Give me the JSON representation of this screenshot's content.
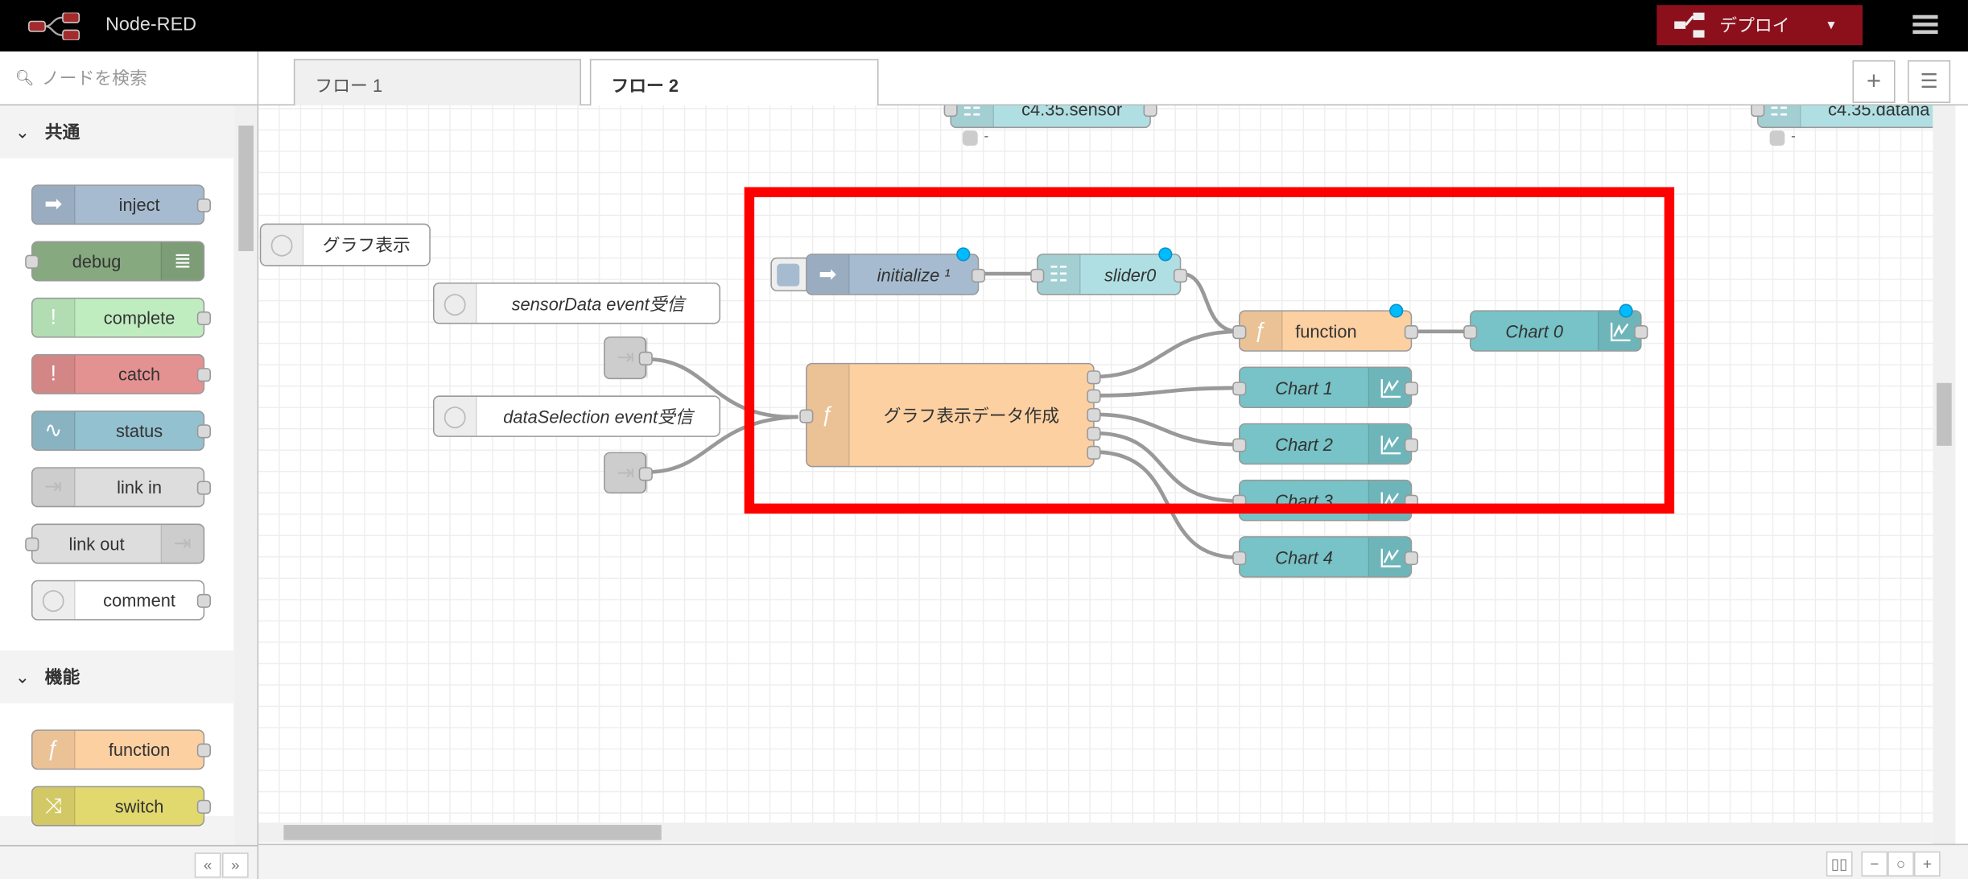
{
  "header": {
    "app_title": "Node-RED",
    "deploy_label": "デプロイ",
    "deploy_color": "#8c101c",
    "menu_icon": "hamburger-icon"
  },
  "palette": {
    "search_placeholder": "ノードを検索",
    "categories": [
      {
        "label": "共通",
        "nodes": [
          "inject",
          "debug",
          "complete",
          "catch",
          "status",
          "link in",
          "link out",
          "comment"
        ]
      },
      {
        "label": "機能",
        "nodes": [
          "function",
          "switch"
        ]
      }
    ]
  },
  "tabs": [
    {
      "label": "フロー 1",
      "active": false
    },
    {
      "label": "フロー 2",
      "active": true
    }
  ],
  "canvas": {
    "nodes": {
      "sensor": {
        "label": "c4.35.sensor",
        "status": "-"
      },
      "datana": {
        "label": "c4.35.datana",
        "status": "-"
      },
      "comment1": "グラフ表示",
      "comment2": "sensorData event受信",
      "comment3": "dataSelection event受信",
      "initialize": "initialize ¹",
      "slider": "slider0",
      "function": "function",
      "chart0": "Chart 0",
      "makedata": "グラフ表示データ作成",
      "chart1": "Chart 1",
      "chart2": "Chart 2",
      "chart3": "Chart 3",
      "chart4": "Chart 4"
    },
    "highlight_color": "#ff0000"
  }
}
